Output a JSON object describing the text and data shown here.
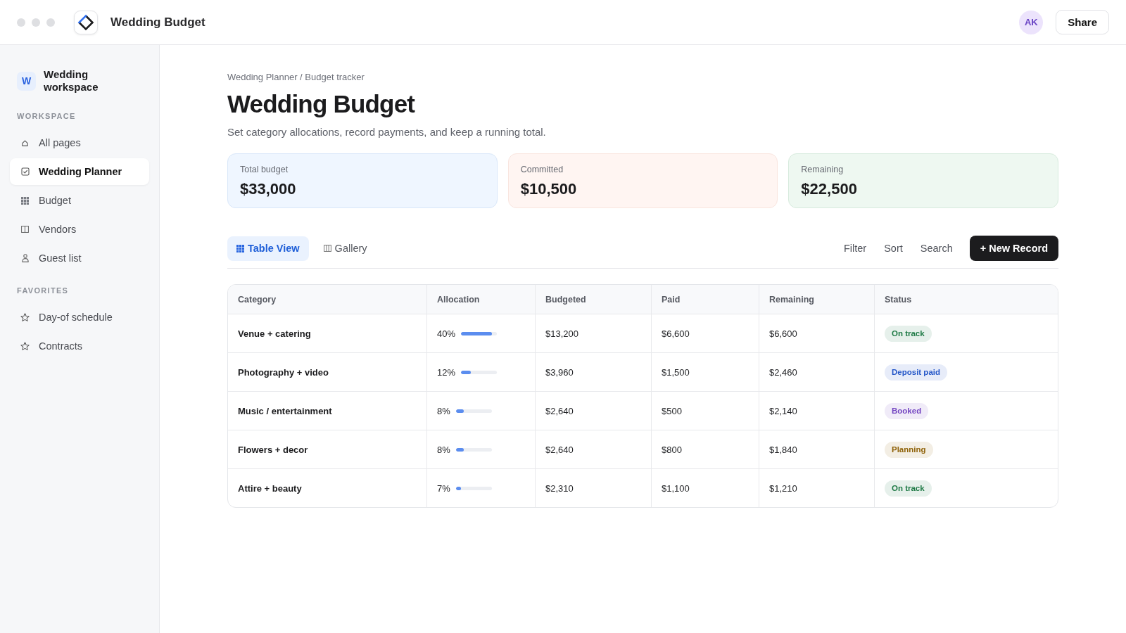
{
  "window": {
    "title": "Wedding Budget"
  },
  "header": {
    "avatar": "AK",
    "share_button": "Share"
  },
  "sidebar": {
    "workspace": {
      "initial": "W",
      "name": "Wedding workspace"
    },
    "sections": [
      {
        "title": "WORKSPACE",
        "items": [
          {
            "label": "All pages",
            "selected": false
          },
          {
            "label": "Wedding Planner",
            "selected": true
          },
          {
            "label": "Budget",
            "selected": false
          },
          {
            "label": "Vendors",
            "selected": false
          },
          {
            "label": "Guest list",
            "selected": false
          }
        ]
      },
      {
        "title": "FAVORITES",
        "items": [
          {
            "label": "Day-of schedule",
            "selected": false
          },
          {
            "label": "Contracts",
            "selected": false
          }
        ]
      }
    ]
  },
  "page": {
    "breadcrumb": "Wedding Planner / Budget tracker",
    "title": "Wedding Budget",
    "subtitle": "Set category allocations, record payments, and keep a running total.",
    "summary_cards": [
      {
        "label": "Total budget",
        "value": "$33,000",
        "color": "#eff6ff"
      },
      {
        "label": "Committed",
        "value": "$10,500",
        "color": "#fff5f2"
      },
      {
        "label": "Remaining",
        "value": "$22,500",
        "color": "#eef8f1"
      }
    ],
    "views": [
      {
        "label": "Table View",
        "selected": true
      },
      {
        "label": "Gallery",
        "selected": false
      }
    ],
    "actions": [
      "Filter",
      "Sort",
      "Search"
    ],
    "new_button": "+ New Record",
    "table": {
      "columns": [
        "Category",
        "Allocation",
        "Budgeted",
        "Paid",
        "Remaining",
        "Status"
      ],
      "rows": [
        {
          "category": "Venue + catering",
          "allocation": "40%",
          "level": 0.87,
          "budgeted": "$13,200",
          "paid": "$6,600",
          "remaining": "$6,600",
          "status": {
            "label": "On track",
            "color": "#1f7a46"
          }
        },
        {
          "category": "Photography + video",
          "allocation": "12%",
          "level": 0.27,
          "budgeted": "$3,960",
          "paid": "$1,500",
          "remaining": "$2,460",
          "status": {
            "label": "Deposit paid",
            "color": "#2456c8"
          }
        },
        {
          "category": "Music / entertainment",
          "allocation": "8%",
          "level": 0.21,
          "budgeted": "$2,640",
          "paid": "$500",
          "remaining": "$2,140",
          "status": {
            "label": "Booked",
            "color": "#7446c2"
          }
        },
        {
          "category": "Flowers + decor",
          "allocation": "8%",
          "level": 0.21,
          "budgeted": "$2,640",
          "paid": "$800",
          "remaining": "$1,840",
          "status": {
            "label": "Planning",
            "color": "#8f6209"
          }
        },
        {
          "category": "Attire + beauty",
          "allocation": "7%",
          "level": 0.15,
          "budgeted": "$2,310",
          "paid": "$1,100",
          "remaining": "$1,210",
          "status": {
            "label": "On track",
            "color": "#1f7a46"
          }
        }
      ]
    }
  }
}
